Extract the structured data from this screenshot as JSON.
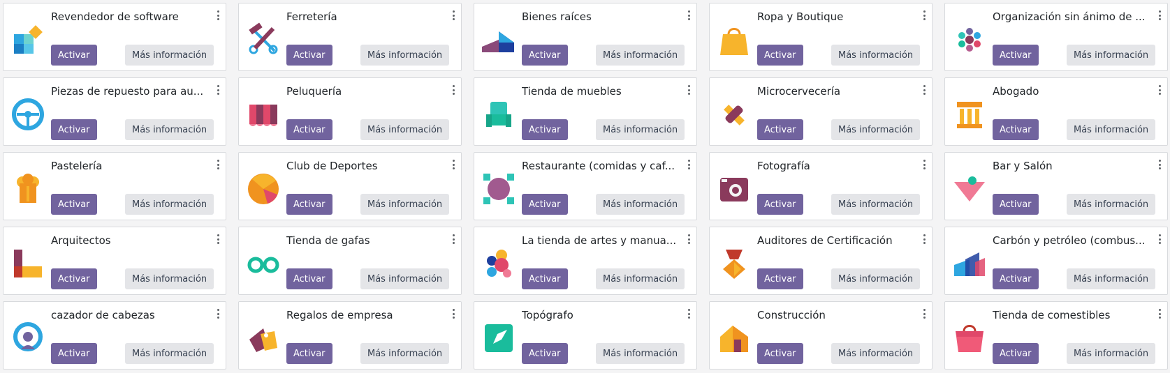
{
  "colors": {
    "primary": "#71639e",
    "secondary_bg": "#e4e5e8",
    "card_border": "#d8dadd"
  },
  "buttons": {
    "activate_label": "Activar",
    "more_info_label": "Más información"
  },
  "modules": [
    {
      "title": "Revendedor de software",
      "icon": "software-reseller-icon"
    },
    {
      "title": "Ferretería",
      "icon": "hardware-store-icon"
    },
    {
      "title": "Bienes raíces",
      "icon": "real-estate-icon"
    },
    {
      "title": "Ropa y Boutique",
      "icon": "clothing-boutique-icon"
    },
    {
      "title": "Organización sin ánimo de ...",
      "icon": "nonprofit-icon"
    },
    {
      "title": "Piezas de repuesto para au...",
      "icon": "auto-parts-icon"
    },
    {
      "title": "Peluquería",
      "icon": "hair-salon-icon"
    },
    {
      "title": "Tienda de muebles",
      "icon": "furniture-store-icon"
    },
    {
      "title": "Microcervecería",
      "icon": "microbrewery-icon"
    },
    {
      "title": "Abogado",
      "icon": "lawyer-icon"
    },
    {
      "title": "Pastelería",
      "icon": "bakery-icon"
    },
    {
      "title": "Club de Deportes",
      "icon": "sports-club-icon"
    },
    {
      "title": "Restaurante (comidas y caf...",
      "icon": "restaurant-icon"
    },
    {
      "title": "Fotografía",
      "icon": "photography-icon"
    },
    {
      "title": "Bar y Salón",
      "icon": "bar-lounge-icon"
    },
    {
      "title": "Arquitectos",
      "icon": "architects-icon"
    },
    {
      "title": "Tienda de gafas",
      "icon": "eyewear-store-icon"
    },
    {
      "title": "La tienda de artes y manua...",
      "icon": "arts-crafts-icon"
    },
    {
      "title": "Auditores de Certificación",
      "icon": "certification-auditors-icon"
    },
    {
      "title": "Carbón y petróleo (combus...",
      "icon": "fuel-icon"
    },
    {
      "title": "cazador de cabezas",
      "icon": "headhunter-icon"
    },
    {
      "title": "Regalos de empresa",
      "icon": "corporate-gifts-icon"
    },
    {
      "title": "Topógrafo",
      "icon": "surveyor-icon"
    },
    {
      "title": "Construcción",
      "icon": "construction-icon"
    },
    {
      "title": "Tienda de comestibles",
      "icon": "grocery-store-icon"
    }
  ]
}
